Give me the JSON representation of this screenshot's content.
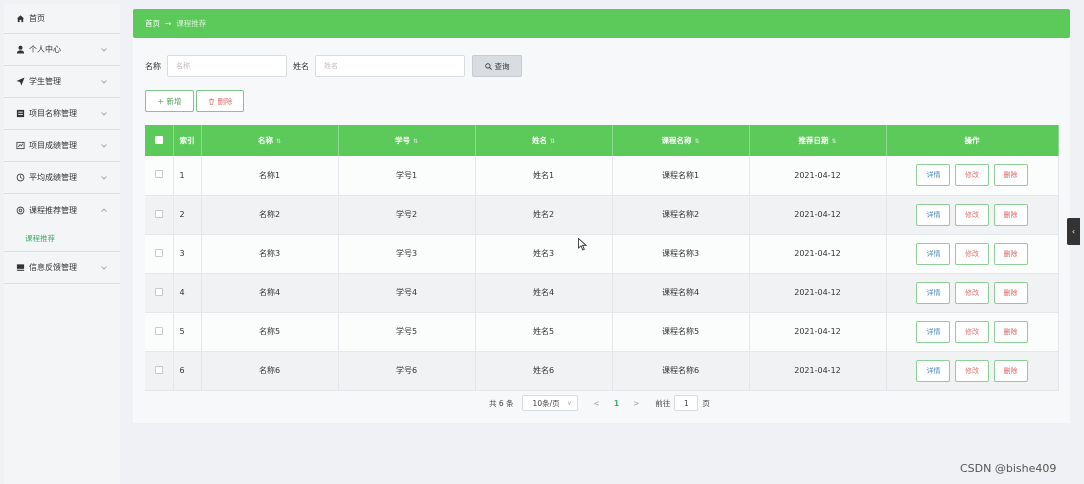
{
  "sidebar": {
    "items": [
      {
        "label": "首页",
        "icon": "home-icon"
      },
      {
        "label": "个人中心",
        "icon": "user-icon"
      },
      {
        "label": "学生管理",
        "icon": "send-icon"
      },
      {
        "label": "项目名称管理",
        "icon": "folder-icon"
      },
      {
        "label": "项目成绩管理",
        "icon": "chart-icon"
      },
      {
        "label": "平均成绩管理",
        "icon": "circle-icon"
      },
      {
        "label": "课程推荐管理",
        "icon": "settings-icon"
      },
      {
        "label": "信息反馈管理",
        "icon": "list-icon"
      }
    ],
    "submenu_label": "课程推荐"
  },
  "breadcrumb": {
    "home": "首页",
    "separator": "→",
    "current": "课程推荐"
  },
  "search": {
    "name_label": "名称",
    "name_placeholder": "名称",
    "surname_label": "姓名",
    "surname_placeholder": "姓名",
    "query_label": "查询"
  },
  "actions": {
    "add_label": "+ 新增",
    "delete_label": "删除"
  },
  "table": {
    "headers": {
      "index": "索引",
      "name": "名称",
      "student_id": "学号",
      "person": "姓名",
      "course": "课程名称",
      "date": "推荐日期",
      "ops": "操作"
    },
    "op_labels": {
      "detail": "详情",
      "edit": "修改",
      "delete": "删除"
    },
    "rows": [
      {
        "index": "1",
        "name": "名称1",
        "student_id": "学号1",
        "person": "姓名1",
        "course": "课程名称1",
        "date": "2021-04-12"
      },
      {
        "index": "2",
        "name": "名称2",
        "student_id": "学号2",
        "person": "姓名2",
        "course": "课程名称2",
        "date": "2021-04-12"
      },
      {
        "index": "3",
        "name": "名称3",
        "student_id": "学号3",
        "person": "姓名3",
        "course": "课程名称3",
        "date": "2021-04-12"
      },
      {
        "index": "4",
        "name": "名称4",
        "student_id": "学号4",
        "person": "姓名4",
        "course": "课程名称4",
        "date": "2021-04-12"
      },
      {
        "index": "5",
        "name": "名称5",
        "student_id": "学号5",
        "person": "姓名5",
        "course": "课程名称5",
        "date": "2021-04-12"
      },
      {
        "index": "6",
        "name": "名称6",
        "student_id": "学号6",
        "person": "姓名6",
        "course": "课程名称6",
        "date": "2021-04-12"
      }
    ]
  },
  "pagination": {
    "total": "共 6 条",
    "page_size": "10条/页",
    "prev": "<",
    "current_page": "1",
    "next": ">",
    "goto_label": "前往",
    "goto_value": "1",
    "page_unit": "页"
  },
  "watermark": "CSDN @bishe409",
  "colors": {
    "accent": "#5cc95b",
    "sidebar_bg": "#f4f5f7"
  }
}
